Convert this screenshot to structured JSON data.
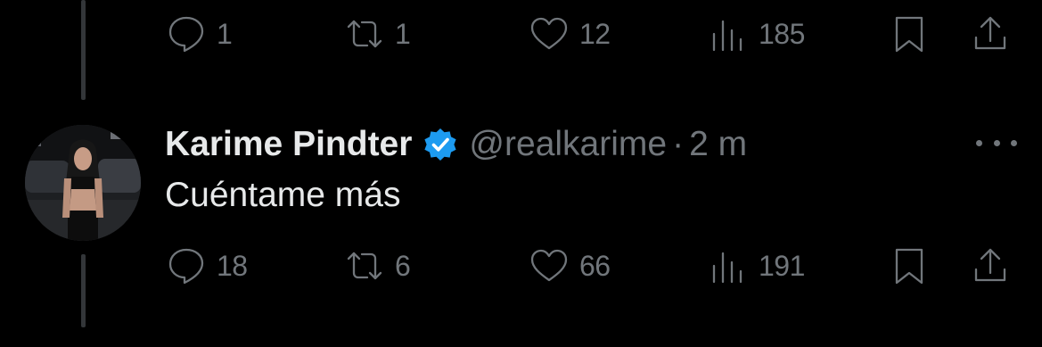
{
  "previous_tweet": {
    "actions": {
      "reply_count": "1",
      "retweet_count": "1",
      "like_count": "12",
      "view_count": "185"
    }
  },
  "tweet": {
    "display_name": "Karime Pindter",
    "handle": "@realkarime",
    "separator": "·",
    "time": "2 m",
    "text": "Cuéntame más",
    "actions": {
      "reply_count": "18",
      "retweet_count": "6",
      "like_count": "66",
      "view_count": "191"
    }
  },
  "colors": {
    "background": "#000000",
    "primary_text": "#e7e9ea",
    "secondary_text": "#71767b",
    "verified_badge": "#1d9bf0",
    "thread_line": "#333639"
  },
  "icons": {
    "reply": "reply-icon",
    "retweet": "retweet-icon",
    "like": "heart-icon",
    "views": "views-icon",
    "bookmark": "bookmark-icon",
    "share": "share-icon",
    "verified": "verified-badge-icon",
    "more": "more-icon"
  }
}
